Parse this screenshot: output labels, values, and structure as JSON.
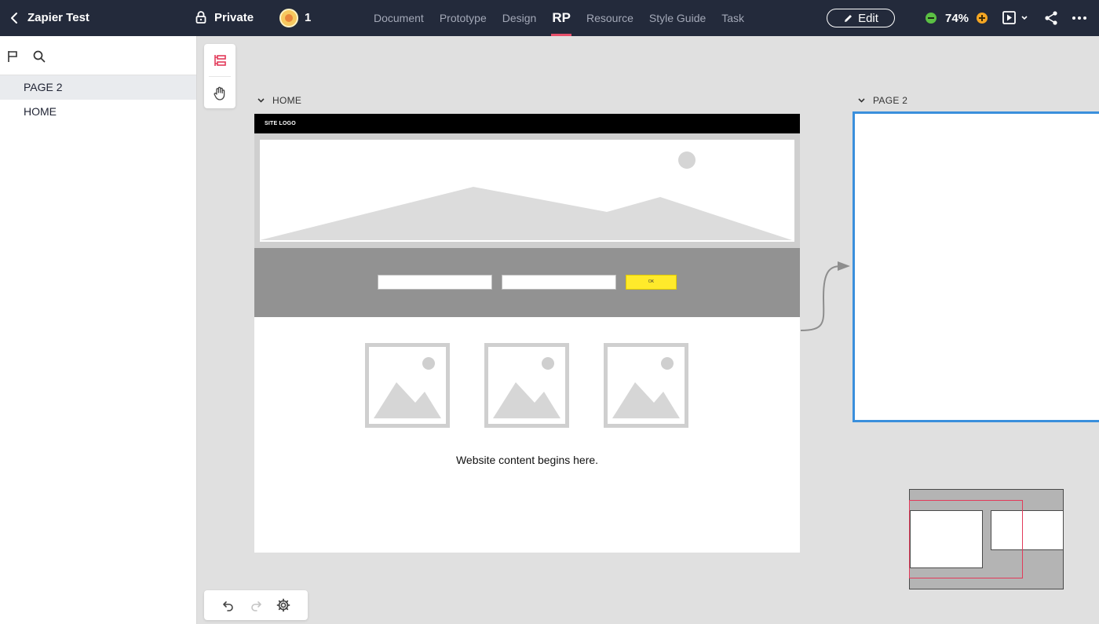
{
  "topbar": {
    "project_title": "Zapier Test",
    "privacy": "Private",
    "member_count": "1",
    "tabs": [
      "Document",
      "Prototype",
      "Design",
      "RP",
      "Resource",
      "Style Guide",
      "Task"
    ],
    "active_tab": "RP",
    "edit_label": "Edit",
    "zoom_level": "74%"
  },
  "sidebar": {
    "pages": [
      "PAGE 2",
      "HOME"
    ],
    "selected_page": "PAGE 2"
  },
  "canvas": {
    "home_label": "HOME",
    "page2_label": "PAGE 2",
    "site_logo": "SITE LOGO",
    "ok_button": "OK",
    "content_text": "Website content begins here."
  },
  "colors": {
    "topbar_bg": "#232a3b",
    "active_tab_underline": "#e64f6a",
    "selection_blue": "#3a8fdc",
    "ok_button_yellow": "#ffea2b",
    "minimap_viewport": "#e23a5a"
  }
}
